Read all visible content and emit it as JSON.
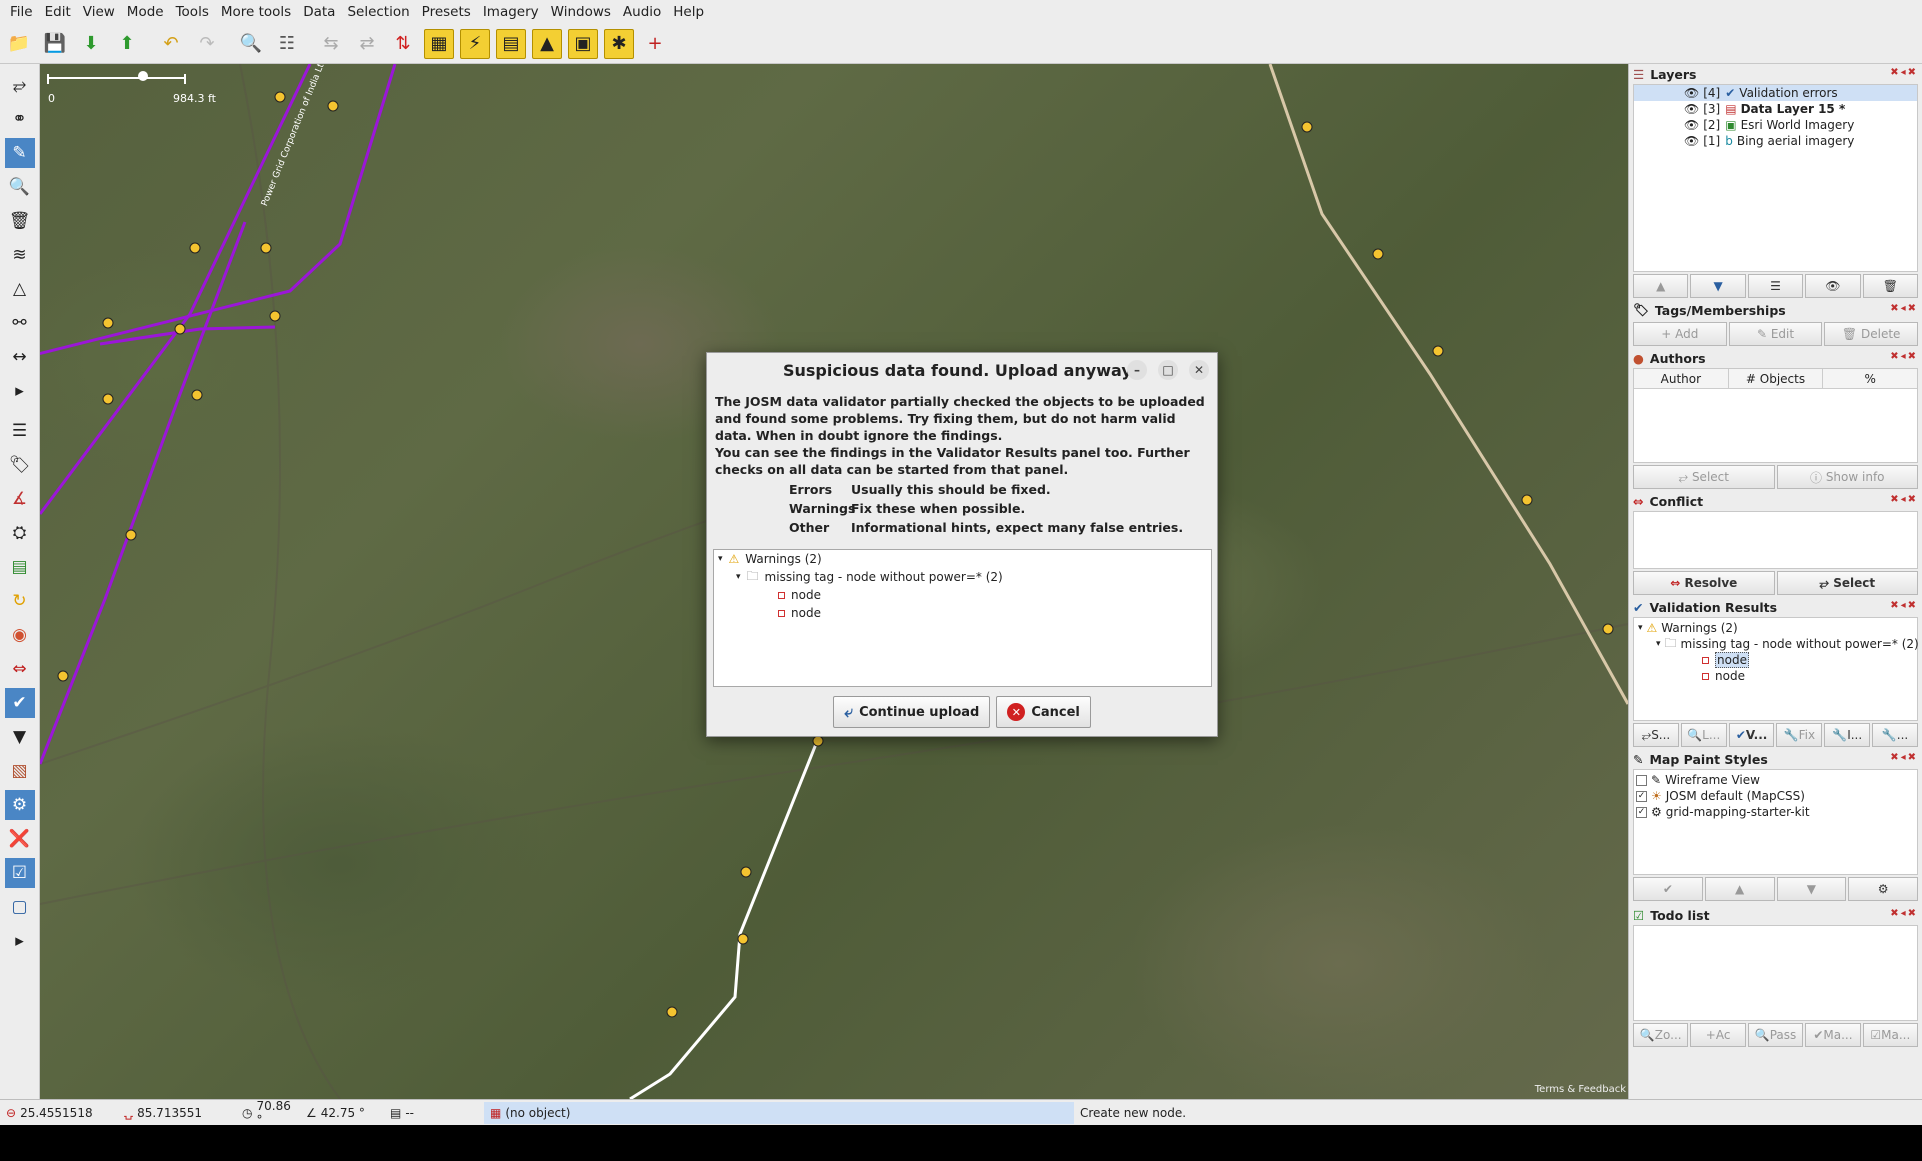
{
  "menu": [
    "File",
    "Edit",
    "View",
    "Mode",
    "Tools",
    "More tools",
    "Data",
    "Selection",
    "Presets",
    "Imagery",
    "Windows",
    "Audio",
    "Help"
  ],
  "toolbar_icons": [
    "open-file-icon",
    "save-icon",
    "download-icon",
    "upload-icon",
    "undo-icon",
    "redo-icon",
    "zoom-icon",
    "preferences-icon",
    "align-icon",
    "split-icon",
    "upload-changes-icon",
    "grid-icon",
    "pylon-icon",
    "power-line-icon",
    "tower-icon",
    "transformer-icon",
    "wind-turbine-icon",
    "add-icon"
  ],
  "left_tools": [
    "select-icon",
    "lasso-icon",
    "draw-icon",
    "zoom-icon",
    "delete-icon",
    "improve-way-icon",
    "parallel-icon",
    "split-way-icon",
    "extract-node-icon",
    "more-icon",
    "layers-icon",
    "tags-icon",
    "measure-icon",
    "relation-icon",
    "map-icon",
    "refresh-icon",
    "style-icon",
    "conflict-icon",
    "validator-icon",
    "filter-icon",
    "history-icon",
    "settings-icon",
    "close-icon",
    "todo-icon",
    "wireframe-icon",
    "more-icon"
  ],
  "map": {
    "scale_zero": "0",
    "scale_value": "984.3 ft",
    "line_label": "Power Grid Corporation of India Ltd",
    "terms": "Terms & Feedback"
  },
  "layers": {
    "title": "Layers",
    "items": [
      {
        "index": "[4]",
        "name": "Validation errors",
        "selected": true
      },
      {
        "index": "[3]",
        "name": "Data Layer 15 *",
        "bold": true
      },
      {
        "index": "[2]",
        "name": "Esri World Imagery"
      },
      {
        "index": "[1]",
        "name": "Bing aerial imagery"
      }
    ]
  },
  "tags": {
    "title": "Tags/Memberships",
    "add": "Add",
    "edit": "Edit",
    "delete": "Delete"
  },
  "authors": {
    "title": "Authors",
    "col_author": "Author",
    "col_objects": "# Objects",
    "col_pct": "%",
    "select": "Select",
    "show_info": "Show info"
  },
  "conflict": {
    "title": "Conflict",
    "resolve": "Resolve",
    "select": "Select"
  },
  "validation": {
    "title": "Validation Results",
    "warnings": "Warnings (2)",
    "group": "missing tag - node without power=* (2)",
    "node1": "node",
    "node2": "node",
    "tabs": [
      "S...",
      "L...",
      "V...",
      "Fix",
      "I...",
      "..."
    ]
  },
  "mappaint": {
    "title": "Map Paint Styles",
    "items": [
      {
        "label": "Wireframe View",
        "checked": false
      },
      {
        "label": "JOSM default (MapCSS)",
        "checked": true
      },
      {
        "label": "grid-mapping-starter-kit",
        "checked": true
      }
    ]
  },
  "todo": {
    "title": "Todo list",
    "buttons": [
      "Zo...",
      "Ac",
      "Pass",
      "Ma...",
      "Ma..."
    ]
  },
  "status": {
    "lat": "25.4551518",
    "lon": "85.713551",
    "heading": "70.86 °",
    "angle": "42.75 °",
    "length": "--",
    "object": "(no object)",
    "message": "Create new node."
  },
  "dialog": {
    "title": "Suspicious data found. Upload anyway?",
    "para1": "The JOSM data validator partially checked the objects to be uploaded and found some problems. Try fixing them, but do not harm valid data. When in doubt ignore the findings.",
    "para2": "You can see the findings in the Validator Results panel too. Further checks on all data can be started from that panel.",
    "legend": [
      {
        "key": "Errors",
        "value": "Usually this should be fixed."
      },
      {
        "key": "Warnings",
        "value": "Fix these when possible."
      },
      {
        "key": "Other",
        "value": "Informational hints, expect many false entries."
      }
    ],
    "tree_warnings": "Warnings (2)",
    "tree_group": "missing tag - node without power=* (2)",
    "tree_node1": "node",
    "tree_node2": "node",
    "continue": "Continue upload",
    "cancel": "Cancel"
  }
}
